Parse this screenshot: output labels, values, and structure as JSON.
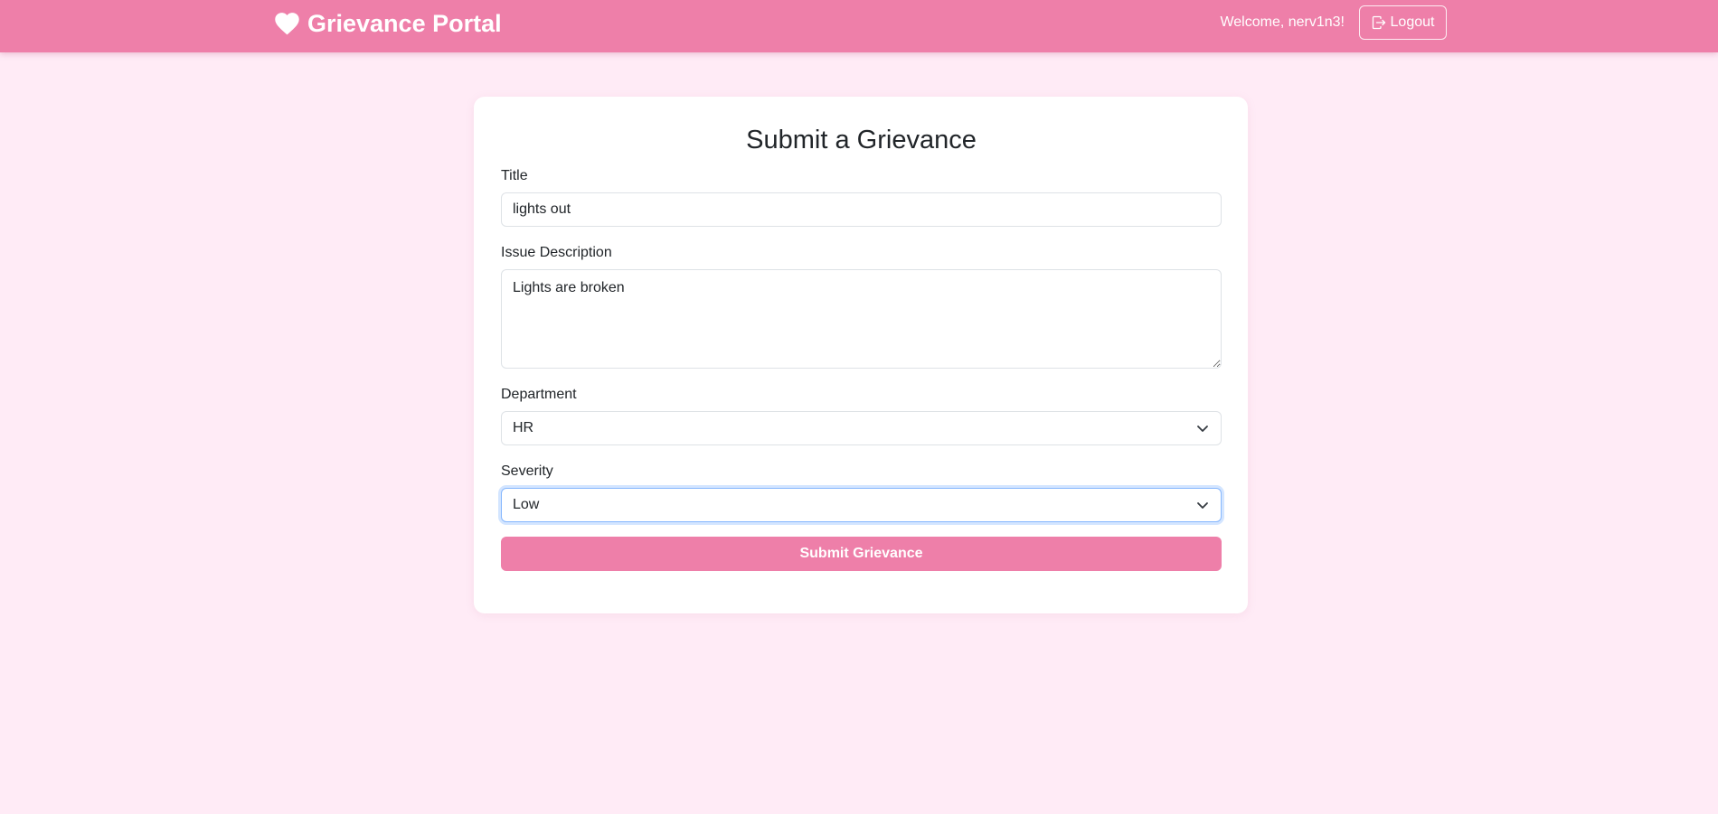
{
  "navbar": {
    "brand": "Grievance Portal",
    "brand_icon": "heart-icon",
    "welcome": "Welcome, nerv1n3!",
    "logout_label": "Logout",
    "logout_icon": "logout-icon",
    "color": "#ee7fa9"
  },
  "form": {
    "heading": "Submit a Grievance",
    "title": {
      "label": "Title",
      "value": "lights out"
    },
    "description": {
      "label": "Issue Description",
      "value": "Lights are broken"
    },
    "department": {
      "label": "Department",
      "selected": "HR"
    },
    "severity": {
      "label": "Severity",
      "selected": "Low"
    },
    "submit_label": "Submit Grievance"
  },
  "colors": {
    "accent": "#ee7fa9",
    "background": "#ffebf6",
    "card": "#ffffff"
  }
}
